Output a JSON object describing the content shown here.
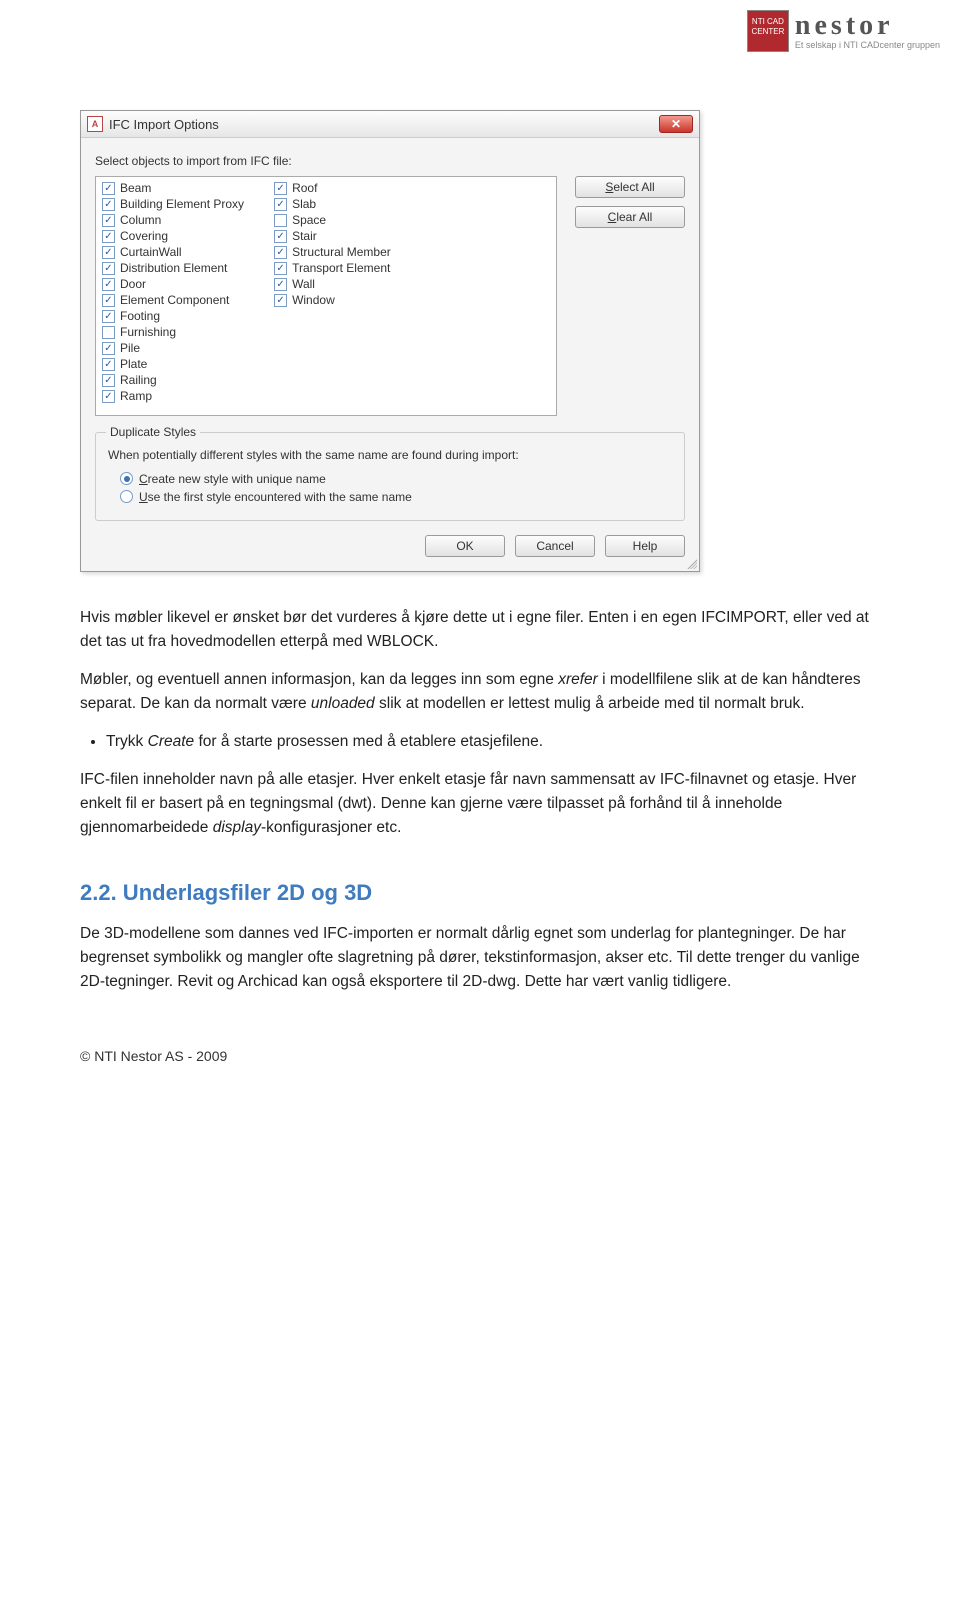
{
  "logo": {
    "badge_line1": "NTI CAD",
    "badge_line2": "CENTER",
    "word": "nestor",
    "sub": "Et selskap i NTI CADcenter gruppen"
  },
  "dialog": {
    "title": "IFC Import Options",
    "instruction": "Select objects to import from IFC file:",
    "col1": [
      {
        "label": "Beam",
        "checked": true
      },
      {
        "label": "Building Element Proxy",
        "checked": true
      },
      {
        "label": "Column",
        "checked": true
      },
      {
        "label": "Covering",
        "checked": true
      },
      {
        "label": "CurtainWall",
        "checked": true
      },
      {
        "label": "Distribution Element",
        "checked": true
      },
      {
        "label": "Door",
        "checked": true
      },
      {
        "label": "Element Component",
        "checked": true
      },
      {
        "label": "Footing",
        "checked": true
      },
      {
        "label": "Furnishing",
        "checked": false
      },
      {
        "label": "Pile",
        "checked": true
      },
      {
        "label": "Plate",
        "checked": true
      },
      {
        "label": "Railing",
        "checked": true
      },
      {
        "label": "Ramp",
        "checked": true
      }
    ],
    "col2": [
      {
        "label": "Roof",
        "checked": true
      },
      {
        "label": "Slab",
        "checked": true
      },
      {
        "label": "Space",
        "checked": false
      },
      {
        "label": "Stair",
        "checked": true
      },
      {
        "label": "Structural Member",
        "checked": true
      },
      {
        "label": "Transport Element",
        "checked": true
      },
      {
        "label": "Wall",
        "checked": true
      },
      {
        "label": "Window",
        "checked": true
      }
    ],
    "select_all": "Select All",
    "clear_all": "Clear All",
    "group_title": "Duplicate Styles",
    "group_desc": "When potentially different styles with the same name are found during import:",
    "radio1": "Create new style with unique name",
    "radio2": "Use the first style encountered with the same name",
    "ok": "OK",
    "cancel": "Cancel",
    "help": "Help"
  },
  "body": {
    "p1": "Hvis møbler likevel er ønsket bør det vurderes å kjøre dette ut i egne filer. Enten i en egen IFCIMPORT, eller ved at det tas ut fra hovedmodellen etterpå med WBLOCK.",
    "p2a": "Møbler, og eventuell annen informasjon, kan da legges inn som egne ",
    "p2i": "xrefer",
    "p2b": " i modellfilene slik at de kan håndteres separat. De kan da normalt være ",
    "p2c": "unloaded",
    "p2d": " slik at modellen er lettest mulig å arbeide med til normalt bruk.",
    "bullet1a": "Trykk ",
    "bullet1b": "Create",
    "bullet1c": " for å starte prosessen med å etablere etasjefilene.",
    "p3a": "IFC-filen inneholder navn på alle etasjer. Hver enkelt etasje får navn sammensatt av IFC-filnavnet og etasje. Hver enkelt fil er basert på en tegningsmal (dwt). Denne kan gjerne være tilpasset på forhånd til å inneholde gjennomarbeidede ",
    "p3b": "display",
    "p3c": "-konfigurasjoner etc.",
    "h2": "2.2. Underlagsfiler 2D og 3D",
    "p4": "De 3D-modellene som dannes ved IFC-importen er normalt dårlig egnet som underlag for plantegninger. De har begrenset symbolikk og mangler ofte slagretning på dører, tekstinformasjon, akser etc. Til dette trenger du vanlige 2D-tegninger. Revit og Archicad kan også eksportere til 2D-dwg. Dette har vært vanlig tidligere.",
    "footer": "© NTI Nestor AS - 2009"
  }
}
